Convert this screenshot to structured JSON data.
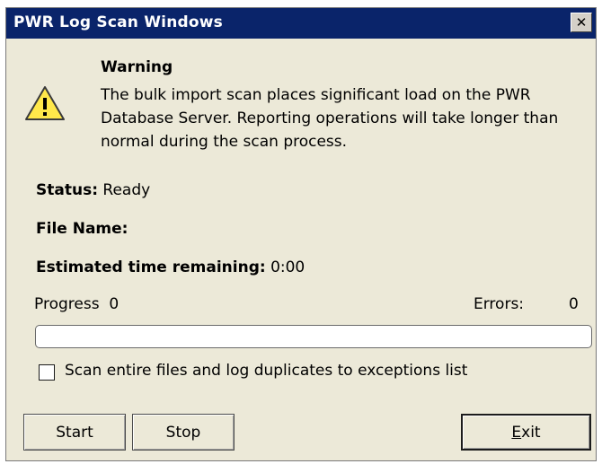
{
  "window": {
    "title": "PWR Log Scan Windows",
    "close_glyph": "✕",
    "close_icon": "close-icon"
  },
  "warning": {
    "icon": "warning-icon",
    "heading": "Warning",
    "message": "The bulk import scan places significant load on the PWR Database Server. Reporting operations will take longer than normal during the scan process."
  },
  "status": {
    "label": "Status:",
    "value": "Ready"
  },
  "file_name": {
    "label": "File Name:",
    "value": ""
  },
  "estimated_time": {
    "label": "Estimated time remaining:",
    "value": "0:00"
  },
  "progress": {
    "label": "Progress",
    "value": "0",
    "fraction": 0
  },
  "errors": {
    "label": "Errors:",
    "value": "0"
  },
  "option": {
    "label": "Scan entire files and log duplicates to exceptions list",
    "checked": false
  },
  "buttons": {
    "start": "Start",
    "stop": "Stop",
    "exit_mnemonic": "E",
    "exit_rest": "xit"
  },
  "colors": {
    "titlebar": "#0a246a",
    "dialog_bg": "#ece9d8",
    "warning_yellow": "#ffe84a"
  }
}
